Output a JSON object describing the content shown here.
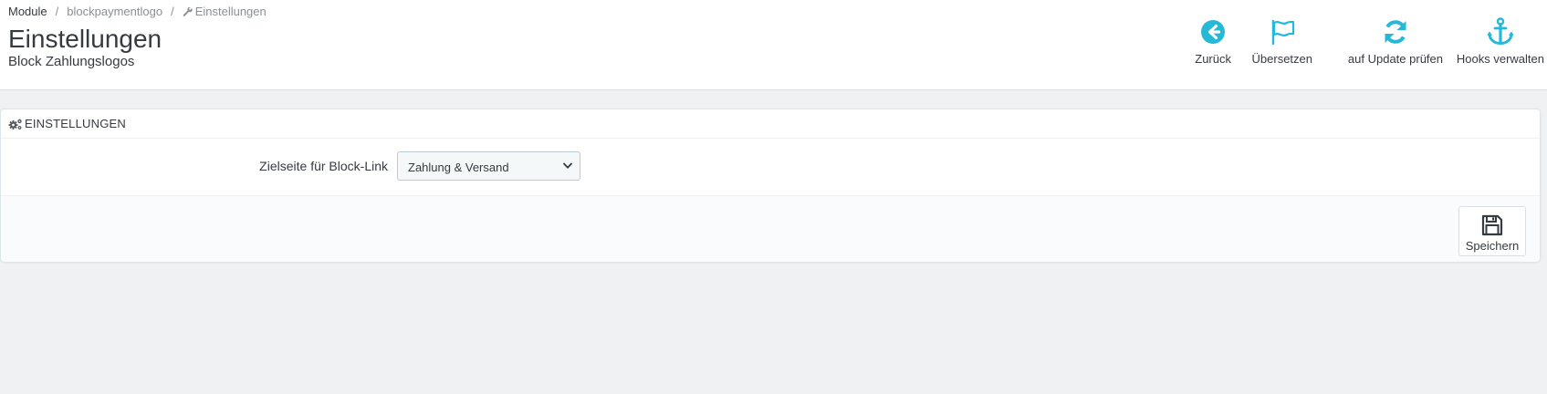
{
  "breadcrumb": {
    "items": [
      "Module",
      "blockpaymentlogo",
      "Einstellungen"
    ],
    "separator": "/"
  },
  "header": {
    "title": "Einstellungen",
    "subtitle": "Block Zahlungslogos"
  },
  "toolbar": {
    "back_label": "Zurück",
    "translate_label": "Übersetzen",
    "update_label": "auf Update prüfen",
    "hooks_label": "Hooks verwalten"
  },
  "panel": {
    "heading": "EINSTELLUNGEN",
    "field_label": "Zielseite für Block-Link",
    "select_value": "Zahlung & Versand",
    "save_label": "Speichern"
  },
  "colors": {
    "accent": "#25b9d7",
    "page_bg": "#eff1f2",
    "text": "#363a41"
  },
  "icons": [
    "arrow-circle-left-icon",
    "flag-icon",
    "refresh-icon",
    "anchor-icon",
    "cogs-icon",
    "wrench-icon",
    "floppy-disk-icon",
    "chevron-down-icon"
  ]
}
